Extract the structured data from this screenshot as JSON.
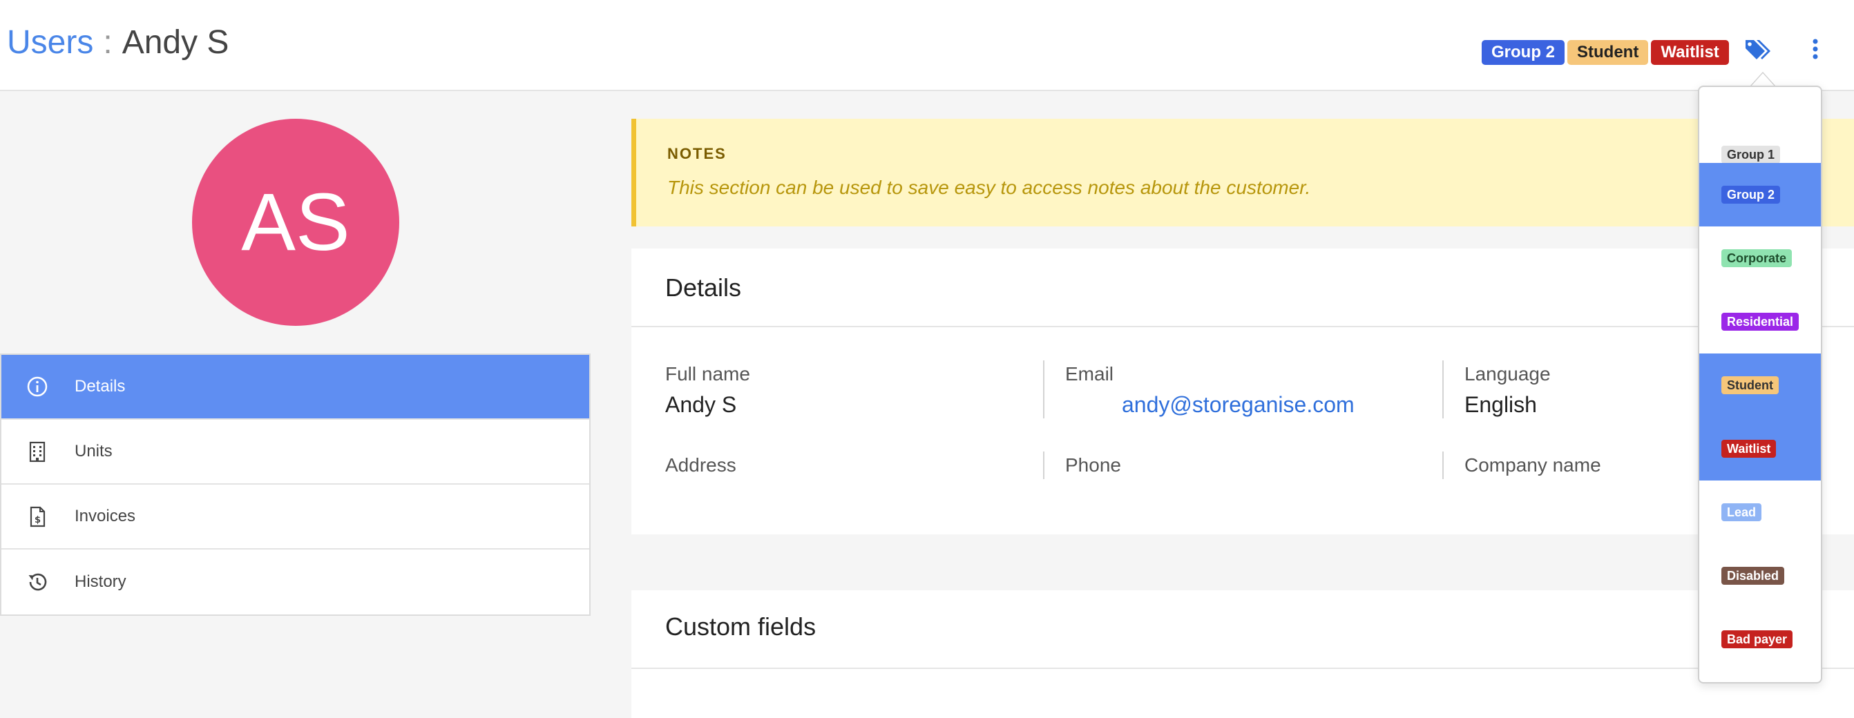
{
  "header": {
    "breadcrumb_parent": "Users",
    "breadcrumb_sep": ":",
    "breadcrumb_current": "Andy S",
    "tags": [
      {
        "label": "Group 2",
        "bg": "#3b63e0",
        "fg": "#ffffff"
      },
      {
        "label": "Student",
        "bg": "#f6c67a",
        "fg": "#222222"
      },
      {
        "label": "Waitlist",
        "bg": "#c5221f",
        "fg": "#ffffff"
      }
    ],
    "tags_icon": "tags-icon",
    "more_icon": "more-vertical-icon",
    "accent": "#2f6fdb"
  },
  "avatar": {
    "initials": "AS",
    "color": "#e95080"
  },
  "sidebar": {
    "items": [
      {
        "label": "Details",
        "icon": "info-icon",
        "active": true
      },
      {
        "label": "Units",
        "icon": "building-icon",
        "active": false
      },
      {
        "label": "Invoices",
        "icon": "invoice-icon",
        "active": false
      },
      {
        "label": "History",
        "icon": "history-icon",
        "active": false
      }
    ]
  },
  "notes": {
    "title": "NOTES",
    "text": "This section can be used to save easy to access notes about the customer."
  },
  "details": {
    "title": "Details",
    "fields": {
      "full_name": {
        "label": "Full name",
        "value": "Andy S"
      },
      "email": {
        "label": "Email",
        "value": "andy@storeganise.com"
      },
      "language": {
        "label": "Language",
        "value": "English"
      },
      "address": {
        "label": "Address",
        "value": ""
      },
      "phone": {
        "label": "Phone",
        "value": ""
      },
      "company": {
        "label": "Company name",
        "value": ""
      }
    }
  },
  "custom_fields": {
    "title": "Custom fields"
  },
  "tag_menu": {
    "items": [
      {
        "label": "Group 1",
        "bg": "#e3e3e3",
        "fg": "#333333",
        "selected": false
      },
      {
        "label": "Group 2",
        "bg": "#3b63e0",
        "fg": "#ffffff",
        "selected": true
      },
      {
        "label": "Corporate",
        "bg": "#8fe3b0",
        "fg": "#1d4d2c",
        "selected": false
      },
      {
        "label": "Residential",
        "bg": "#9b27e8",
        "fg": "#ffffff",
        "selected": false
      },
      {
        "label": "Student",
        "bg": "#f6c67a",
        "fg": "#333333",
        "selected": true
      },
      {
        "label": "Waitlist",
        "bg": "#c5221f",
        "fg": "#ffffff",
        "selected": true
      },
      {
        "label": "Lead",
        "bg": "#8fb4f5",
        "fg": "#ffffff",
        "selected": false
      },
      {
        "label": "Disabled",
        "bg": "#795548",
        "fg": "#ffffff",
        "selected": false
      },
      {
        "label": "Bad payer",
        "bg": "#c5221f",
        "fg": "#ffffff",
        "selected": false
      }
    ],
    "selected_bg": "#5f8ef2"
  }
}
